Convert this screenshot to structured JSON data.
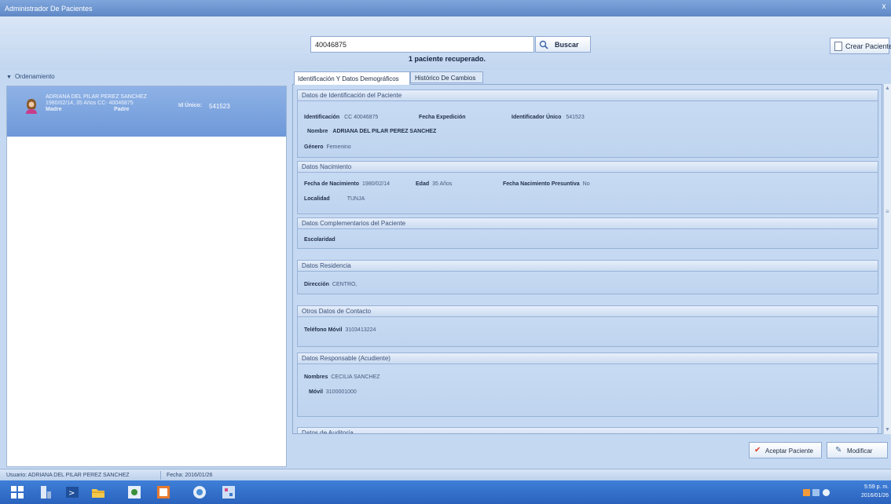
{
  "window": {
    "title": "Administrador De Pacientes",
    "close_glyph": "x"
  },
  "search": {
    "value": "40046875",
    "button_label": "Buscar",
    "result_message": "1 paciente recuperado."
  },
  "toolbar": {
    "create_label": "Crear Paciente"
  },
  "sidebar": {
    "ordenamiento_label": "Ordenamiento",
    "patient": {
      "name": "ADRIANA DEL PILAR PEREZ SANCHEZ",
      "info": "1980/02/14, 35 Años    CC- 40046875",
      "madre_label": "Madre",
      "padre_label": "Padre",
      "id_unico_label": "Id Único:",
      "id_unico_value": "541523"
    }
  },
  "tabs": [
    "Identificación Y Datos Demográficos",
    "Histórico De Cambios"
  ],
  "sections": {
    "identificacion": {
      "header": "Datos de Identificación del Paciente",
      "identificacion_label": "Identificación",
      "identificacion_value": "CC  40046875",
      "fecha_exp_label": "Fecha Expedición",
      "fecha_exp_value": "",
      "id_unico_label": "Identificador Único",
      "id_unico_value": "541523",
      "nombre_label": "Nombre",
      "nombre_value": "ADRIANA DEL PILAR PEREZ SANCHEZ",
      "genero_label": "Género",
      "genero_value": "Femenino"
    },
    "nacimiento": {
      "header": "Datos Nacimiento",
      "fecha_nac_label": "Fecha de Nacimiento",
      "fecha_nac_value": "1980/02/14",
      "edad_label": "Edad",
      "edad_value": "35 Años",
      "presuntiva_label": "Fecha Nacimiento Presuntiva",
      "presuntiva_value": "No",
      "localidad_label": "Localidad",
      "localidad_value": "TUNJA"
    },
    "complementarios": {
      "header": "Datos Complementarios del Paciente",
      "escolaridad_label": "Escolaridad"
    },
    "residencia": {
      "header": "Datos Residencia",
      "direccion_label": "Dirección",
      "direccion_value": "CENTRO,"
    },
    "contacto": {
      "header": "Otros Datos de Contacto",
      "movil_label": "Teléfono Móvil",
      "movil_value": "3103413224"
    },
    "responsable": {
      "header": "Datos Responsable (Acudiente)",
      "nombres_label": "Nombres",
      "nombres_value": "CECILIA SANCHEZ",
      "movil_label": "Móvil",
      "movil_value": "3100001000"
    },
    "auditoria": {
      "header": "Datos de Auditoría"
    }
  },
  "actions": {
    "accept_label": "Aceptar Paciente",
    "modify_label": "Modificar"
  },
  "statusbar": {
    "user": "Usuario: ADRIANA DEL PILAR PEREZ SANCHEZ",
    "date": "Fecha: 2016/01/26"
  },
  "clock": {
    "time": "5:59 p. m.",
    "date": "2016/01/26"
  },
  "colors": {
    "accent": "#6e98d8",
    "panel": "#c5d9f2",
    "taskbar": "#2a63bd"
  }
}
